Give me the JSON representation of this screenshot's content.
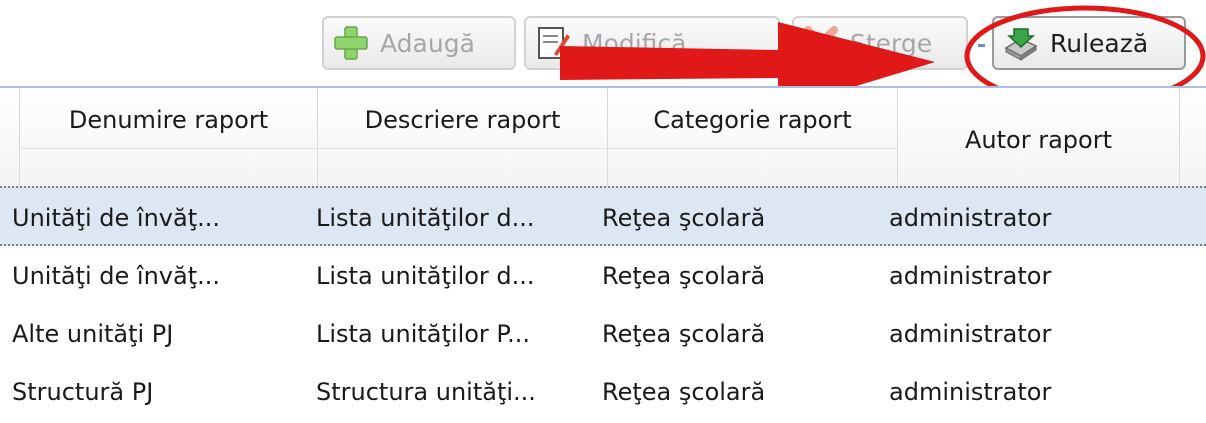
{
  "toolbar": {
    "add_label": "Adaugă",
    "edit_label": "Modifică",
    "delete_label": "Şterge",
    "run_label": "Rulează"
  },
  "table": {
    "columns": [
      "Denumire raport",
      "Descriere raport",
      "Categorie raport",
      "Autor raport"
    ],
    "rows": [
      [
        "Unităţi de învăţ...",
        "Lista unităţilor d...",
        "Reţea şcolară",
        "administrator"
      ],
      [
        "Unităţi de învăţ...",
        "Lista unităţilor d...",
        "Reţea şcolară",
        "administrator"
      ],
      [
        "Alte unităţi PJ",
        "Lista unităţilor P...",
        "Reţea şcolară",
        "administrator"
      ],
      [
        "Structură PJ",
        "Structura unităţi...",
        "Reţea şcolară",
        "administrator"
      ]
    ],
    "selected_row": 0
  },
  "icons": {
    "add": "plus-icon",
    "edit": "edit-document-icon",
    "delete": "delete-icon",
    "run": "run-report-icon"
  },
  "colors": {
    "annotation_red": "#e01818",
    "selected_row_bg": "#dde6f3",
    "add_icon_green": "#7ccb5a"
  }
}
